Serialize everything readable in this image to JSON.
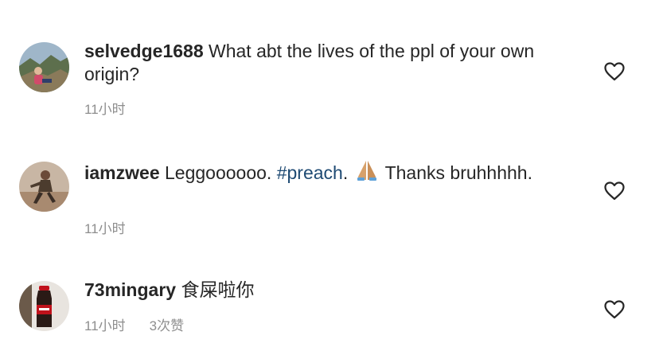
{
  "comments": [
    {
      "username": "selvedge1688",
      "text": " What abt the lives of the ppl of your own origin?",
      "time": "11小时",
      "heart_icon": "heart-outline-icon"
    },
    {
      "username": "iamzwee",
      "text_before": " Leggoooooo. ",
      "hashtag": "#preach",
      "text_after": ". ",
      "emoji_icon": "folded-hands-emoji",
      "text_end": " Thanks bruhhhhh.",
      "time": "11小时",
      "heart_icon": "heart-outline-icon"
    },
    {
      "username": "73mingary",
      "text": " 食屎啦你",
      "time": "11小时",
      "likes": "3次赞",
      "heart_icon": "heart-outline-icon"
    }
  ],
  "colors": {
    "text": "#262626",
    "meta": "#8e8e8e",
    "hashtag": "#1e4a73"
  }
}
